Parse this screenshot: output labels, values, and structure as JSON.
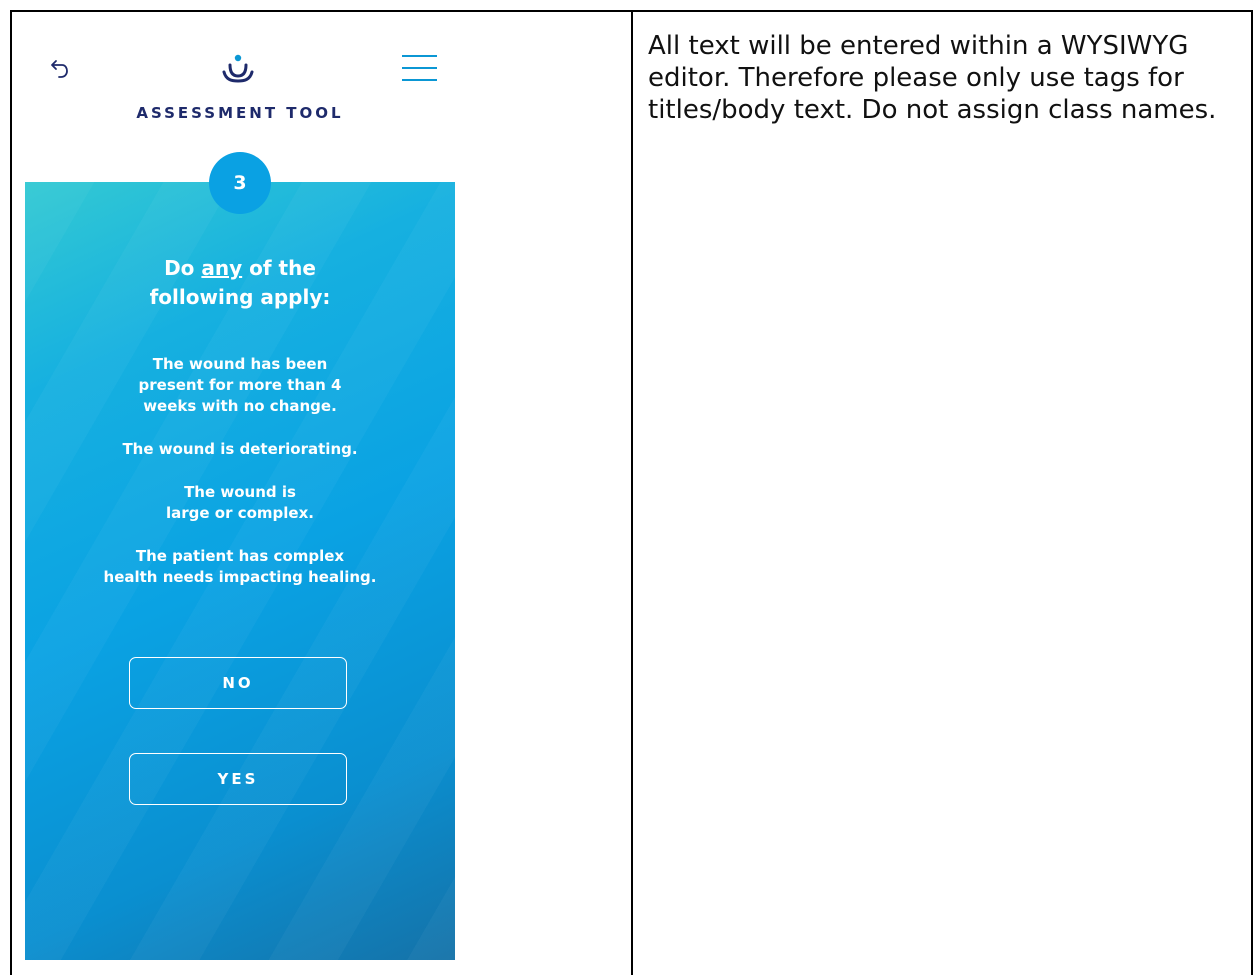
{
  "app": {
    "title": "ASSESSMENT TOOL"
  },
  "header": {
    "back_icon": "back-arrow-icon",
    "logo_icon": "logo-icon",
    "menu_icon": "hamburger-menu-icon",
    "accent_color": "#0b97d4",
    "title_color": "#1e2a6b"
  },
  "step": {
    "number": "3"
  },
  "question": {
    "prefix": "Do ",
    "emphasis": "any",
    "suffix": " of the",
    "line2": "following apply:"
  },
  "conditions": [
    "The wound has been\npresent for more than 4\nweeks with no change.",
    "The wound is deteriorating.",
    "The wound is\nlarge or complex.",
    "The patient has complex\nhealth needs impacting healing."
  ],
  "buttons": {
    "no_label": "NO",
    "yes_label": "YES"
  },
  "note": {
    "text": "All text will be entered within a WYSIWYG editor. Therefore please only use tags for titles/body text. Do not assign class names."
  },
  "colors": {
    "gradient_start": "#33c9d3",
    "gradient_mid": "#0aa2e3",
    "gradient_end": "#1572a8"
  }
}
